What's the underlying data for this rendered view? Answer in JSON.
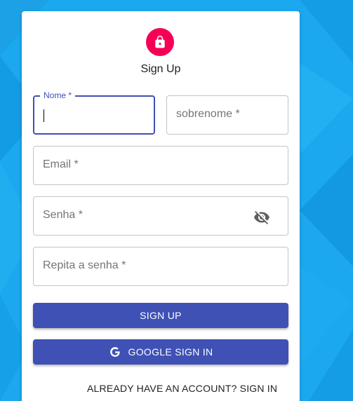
{
  "colors": {
    "background": "#1aa7ec",
    "accent": "#f50057",
    "primary": "#3f51b5"
  },
  "header": {
    "avatar_icon": "lock-icon",
    "title": "Sign Up"
  },
  "form": {
    "first_name": {
      "label": "Nome *",
      "value": ""
    },
    "last_name": {
      "placeholder": "sobrenome *"
    },
    "email": {
      "placeholder": "Email *"
    },
    "password": {
      "placeholder": "Senha *",
      "toggle_icon": "eye-off-icon"
    },
    "confirm_password": {
      "placeholder": "Repita a senha *"
    }
  },
  "buttons": {
    "sign_up": "SIGN UP",
    "google_sign_in": "GOOGLE SIGN IN",
    "google_icon": "google-icon"
  },
  "links": {
    "sign_in": "ALREADY HAVE AN ACCOUNT? SIGN IN"
  }
}
